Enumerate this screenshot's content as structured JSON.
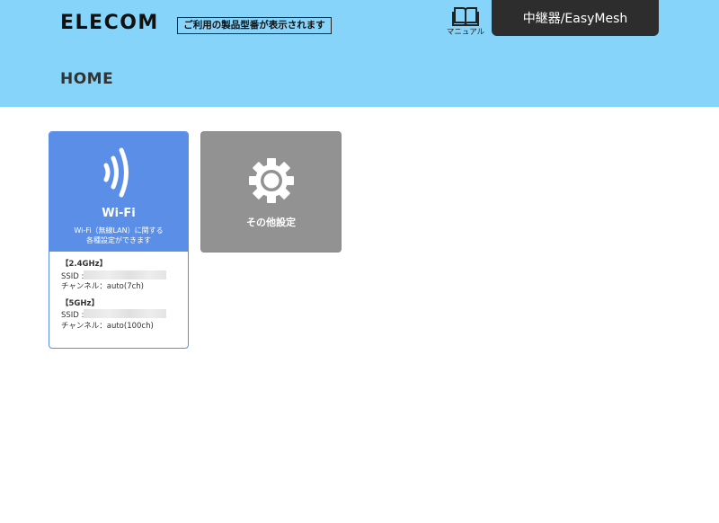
{
  "header": {
    "logo": "ELECOM",
    "model_text": "ご利用の製品型番が表示されます",
    "manual_label": "マニュアル",
    "mode_tab": "中継器/EasyMesh",
    "colors": {
      "header_bg": "#87d4fb",
      "tab_bg": "#2d2d2d"
    }
  },
  "page": {
    "title": "HOME"
  },
  "wifi_card": {
    "icon": "wifi-icon",
    "title": "Wi-Fi",
    "desc_line1": "Wi-Fi（無線LAN）に関する",
    "desc_line2": "各種設定ができます",
    "color": "#5b8fe7",
    "band_24": {
      "heading": "【2.4GHz】",
      "ssid_label": "SSID :",
      "channel": "チャンネル：auto(7ch)"
    },
    "band_5": {
      "heading": "【5GHz】",
      "ssid_label": "SSID :",
      "channel": "チャンネル：auto(100ch)"
    }
  },
  "other_card": {
    "icon": "gear-icon",
    "title": "その他設定",
    "color": "#929292"
  }
}
